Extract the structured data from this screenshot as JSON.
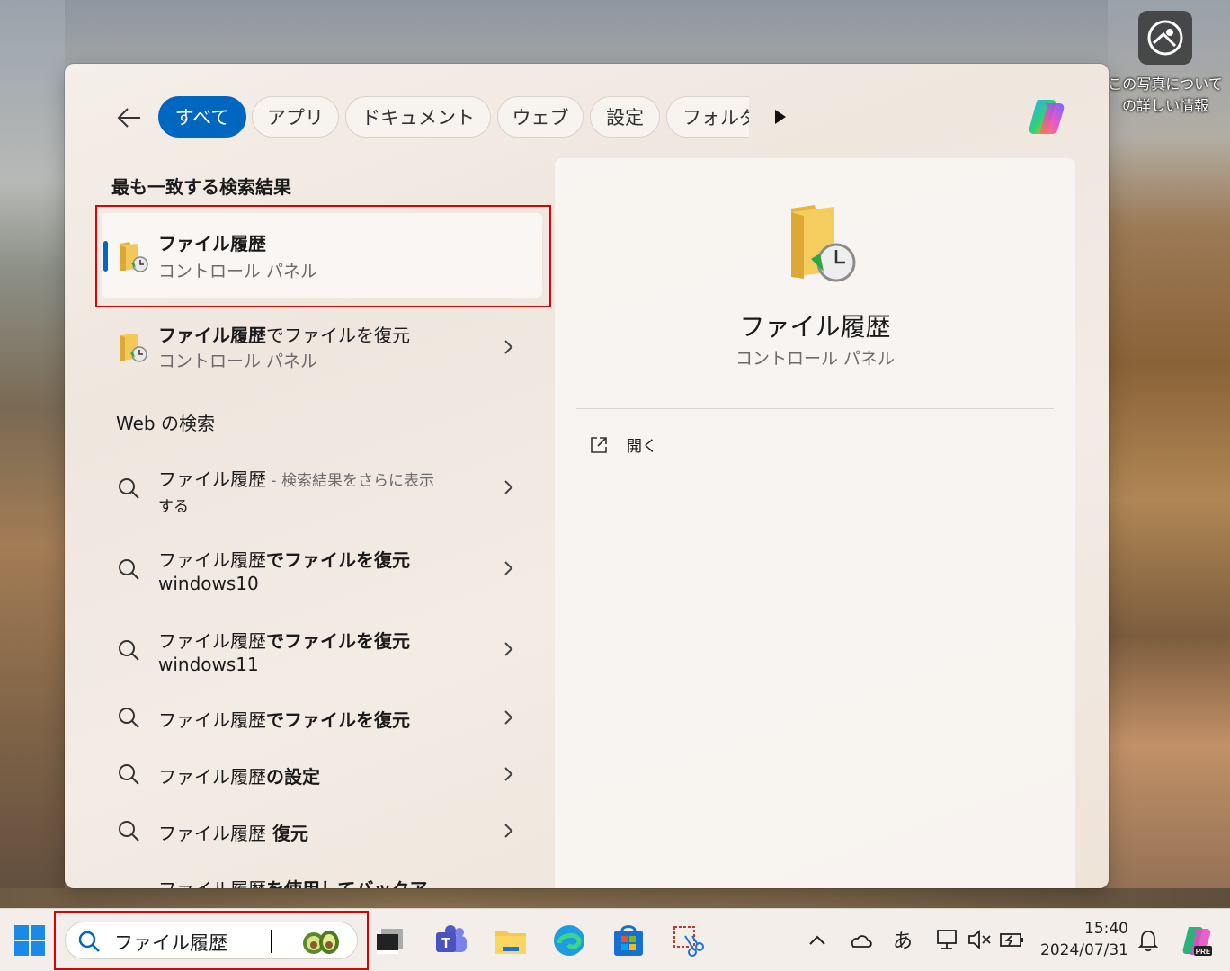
{
  "desktop": {
    "photo_info_label": "この写真についての詳しい情報"
  },
  "search_panel": {
    "filters": [
      "すべて",
      "アプリ",
      "ドキュメント",
      "ウェブ",
      "設定",
      "フォルダ"
    ],
    "active_filter": "すべて",
    "best_match_heading": "最も一致する検索結果",
    "best_match": {
      "title": "ファイル履歴",
      "subtitle": "コントロール パネル"
    },
    "second_result": {
      "title_bold": "ファイル履歴",
      "title_rest": "でファイルを復元",
      "subtitle": "コントロール パネル"
    },
    "web_heading": "Web の検索",
    "web_results": [
      {
        "prefix": "ファイル履歴",
        "suffix": " - 検索結果をさらに表示",
        "line2": "する"
      },
      {
        "prefix": "ファイル履歴",
        "bold": "でファイルを復元",
        "line2": "windows10"
      },
      {
        "prefix": "ファイル履歴",
        "bold": "でファイルを復元",
        "line2": "windows11"
      },
      {
        "prefix": "ファイル履歴",
        "bold": "でファイルを復元"
      },
      {
        "prefix": "ファイル履歴",
        "bold": "の設定"
      },
      {
        "prefix": "ファイル履歴",
        "bold": " 復元"
      },
      {
        "prefix": "ファイル履歴",
        "bold": "を使用してバックア"
      }
    ],
    "details": {
      "title": "ファイル履歴",
      "subtitle": "コントロール パネル",
      "open_label": "開く"
    }
  },
  "taskbar": {
    "search_query": "ファイル履歴",
    "ime_label": "あ",
    "time": "15:40",
    "date": "2024/07/31"
  },
  "colors": {
    "accent": "#0067c0",
    "highlight_box": "#e00000"
  }
}
